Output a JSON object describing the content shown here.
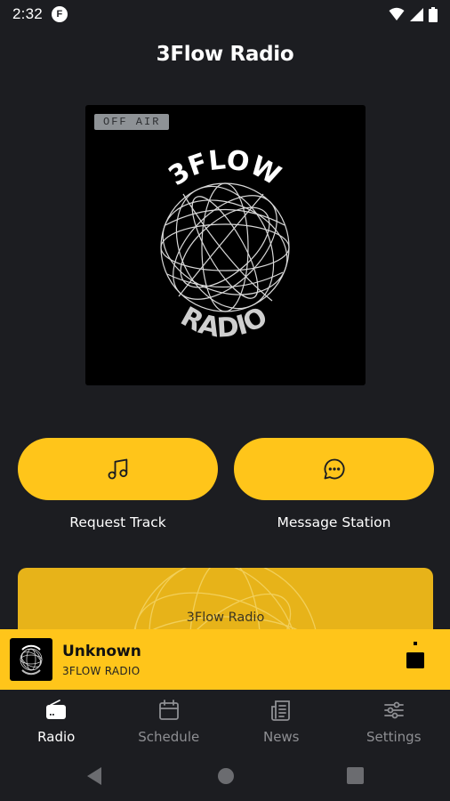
{
  "status_bar": {
    "time": "2:32",
    "app_icon_letter": "F"
  },
  "header": {
    "title": "3Flow Radio"
  },
  "artwork": {
    "badge": "OFF AIR",
    "logo_top_text": "3FLOW",
    "logo_bottom_text": "RADIO"
  },
  "actions": {
    "request_track_label": "Request Track",
    "message_station_label": "Message Station"
  },
  "station_card": {
    "name": "3Flow Radio"
  },
  "mini_player": {
    "title": "Unknown",
    "subtitle": "3FLOW RADIO"
  },
  "bottom_nav": {
    "items": [
      {
        "label": "Radio",
        "icon": "radio-icon",
        "active": true
      },
      {
        "label": "Schedule",
        "icon": "calendar-icon",
        "active": false
      },
      {
        "label": "News",
        "icon": "newspaper-icon",
        "active": false
      },
      {
        "label": "Settings",
        "icon": "sliders-icon",
        "active": false
      }
    ]
  },
  "colors": {
    "background": "#1c1d21",
    "accent": "#ffc51a",
    "card": "#e7b319"
  }
}
